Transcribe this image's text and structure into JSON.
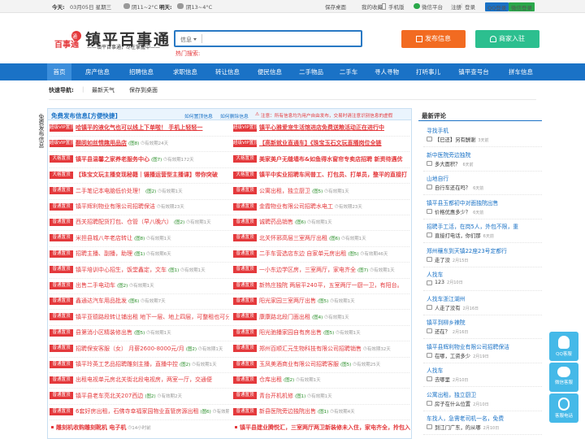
{
  "topbar": {
    "today_label": "今天:",
    "date": "03月05日 星期三",
    "weather_today": "阴11~2°C",
    "tomorrow_label": "明天:",
    "weather_tomorrow": "阴13~4°C",
    "save_desktop": "保存桌面",
    "favorites": "我的收藏",
    "mobile": "手机版",
    "wechat": "微信平台",
    "register": "注册",
    "login": "登录",
    "qq_login": "QQ登录",
    "wechat_login": "微信登录"
  },
  "header": {
    "logo_badge": "百事通",
    "title": "镇平百事通",
    "slogan": "——镇平百事通，尽在掌握中——",
    "search_category": "信息",
    "hot_label": "热门搜索:",
    "post_btn": "发布信息",
    "merchant_btn": "商家入驻"
  },
  "nav": [
    "首页",
    "房产信息",
    "招聘信息",
    "求职信息",
    "转让信息",
    "便民信息",
    "二手物品",
    "二手车",
    "寻人寻物",
    "打听事儿",
    "镇平查号台",
    "拼车信息"
  ],
  "quick": {
    "label": "快速导航:",
    "items": [
      "最新天气",
      "保存到桌面"
    ]
  },
  "panel": {
    "title": "免费发布信息[方便快捷]",
    "link_top": "如何置顶信息",
    "link_delete": "如何删除信息",
    "notice": "注意：所有信息均为用户自由发布，交易时请注意识别信息的虚假",
    "side_text": "免费发布信息"
  },
  "left_rows": [
    {
      "tag": "超级VIP置顶",
      "color": "#e4393c",
      "title": "哈镇平的液化气也可以线上下单啦！ 手机上轻轻一",
      "pic": "",
      "meta": ""
    },
    {
      "tag": "超级VIP置顶",
      "color": "#e4393c",
      "title": "翻阅如丝情趣用品店",
      "pic": "(图8)",
      "meta": "有效期24天"
    },
    {
      "tag": "大格置顶",
      "color": "#e4393c",
      "title": "镇平县温馨之家养老服务中心",
      "pic": "(图7)",
      "meta": "有效期172天"
    },
    {
      "tag": "大格置顶",
      "color": "#e4393c",
      "title": "【珠宝文玩主播变现秘籍｜镊播运营型主播课】带你突破",
      "pic": "",
      "meta": ""
    },
    {
      "tag": "普通置顶",
      "color": "#e4393c",
      "title": "二手笔记本电脑低价处理！",
      "pic": "(图2)",
      "meta": "有效期1天"
    },
    {
      "tag": "普通置顶",
      "color": "#e4393c",
      "title": "镇平辉利物业有限公司招聘保洁",
      "pic": "",
      "meta": "有效期23天"
    },
    {
      "tag": "普通置顶",
      "color": "#e4393c",
      "title": "西关招聘配货打包、仓管（早八晚六）",
      "pic": "(图2)",
      "meta": "有效期1天"
    },
    {
      "tag": "普通置顶",
      "color": "#e4393c",
      "title": "米担县城八年老店转让",
      "pic": "(图8)",
      "meta": "有效期1天"
    },
    {
      "tag": "普通置顶",
      "color": "#e4393c",
      "title": "招聘主播、副播，助理",
      "pic": "(图1)",
      "meta": "有效期6天"
    },
    {
      "tag": "普通置顶",
      "color": "#e4393c",
      "title": "镇平培训中心招生，饭堂鑫定，文车",
      "pic": "(图1)",
      "meta": "有效期1天"
    },
    {
      "tag": "普通置顶",
      "color": "#e4393c",
      "title": "出售二手电动车",
      "pic": "(图2)",
      "meta": "有效期1天"
    },
    {
      "tag": "普通置顶",
      "color": "#e4393c",
      "title": "鑫通达汽车用品批发",
      "pic": "(图6)",
      "meta": "有效期7天"
    },
    {
      "tag": "普通置顶",
      "color": "#e4393c",
      "title": "镇平亚德路段转让铺出租 地下一层、地上四层，可整租也可分",
      "pic": "",
      "meta": ""
    },
    {
      "tag": "普通置顶",
      "color": "#e4393c",
      "title": "县第消小区精装修出售",
      "pic": "(图5)",
      "meta": "有效期1天"
    },
    {
      "tag": "普通置顶",
      "color": "#e4393c",
      "title": "招聘保安客服（女） 月薪2600-8000元/月",
      "pic": "(图2)",
      "meta": "有效期1天"
    },
    {
      "tag": "普通置顶",
      "color": "#e4393c",
      "title": "镇平玲英工艺品招聘雕刻主播，直播中控",
      "pic": "(图2)",
      "meta": "有效期1天"
    },
    {
      "tag": "普通置顶",
      "color": "#e4393c",
      "title": "出租电视单元房北关街北段电视房，两室一厅，交通便",
      "pic": "",
      "meta": ""
    },
    {
      "tag": "普通置顶",
      "color": "#e4393c",
      "title": "镇平县老车亮北关207西边",
      "pic": "(图2)",
      "meta": "有效期2天"
    },
    {
      "tag": "普通置顶",
      "color": "#e4393c",
      "title": "6套好房出租，石佛寺幸福家园物业直管房源出租",
      "pic": "(图6)",
      "meta": "有效期7天"
    },
    {
      "tag": "",
      "color": "#ffffff",
      "title": "雕刻机收购雕刻靴机 电子机",
      "pic": "",
      "meta": "14小时前"
    }
  ],
  "right_rows": [
    {
      "tag": "超级VIP置顶",
      "color": "#e4393c",
      "title": "镇平心雅爱宠生活馆进店免费送粮活动正在进行中",
      "pic": "",
      "meta": ""
    },
    {
      "tag": "超级VIP置顶",
      "color": "#e4393c",
      "title": "【高新就业直通车】《珠宝玉石文玩直播岗位全链",
      "pic": "",
      "meta": ""
    },
    {
      "tag": "大格置顶",
      "color": "#e4393c",
      "title": "美家美户无缝墙布&如鱼得水窗帘专卖店招聘 新资待遇优",
      "pic": "",
      "meta": ""
    },
    {
      "tag": "大格置顶",
      "color": "#e4393c",
      "title": "镇平中实业招聘车间普工、打包员、打单员，整平的直接打",
      "pic": "",
      "meta": ""
    },
    {
      "tag": "普通置顶",
      "color": "#e4393c",
      "title": "公寓出租，独立厨卫",
      "pic": "(图5)",
      "meta": "有效期1天"
    },
    {
      "tag": "普通置顶",
      "color": "#e4393c",
      "title": "金霞物业有限公司招聘水电工",
      "pic": "",
      "meta": "有效期23天"
    },
    {
      "tag": "普通置顶",
      "color": "#e4393c",
      "title": "诚聘药品销售",
      "pic": "(图6)",
      "meta": "有效期1天"
    },
    {
      "tag": "普通置顶",
      "color": "#e4393c",
      "title": "北关怀邪高层三室两厅出租",
      "pic": "(图6)",
      "meta": "有效期1天"
    },
    {
      "tag": "普通置顶",
      "color": "#e4393c",
      "title": "二手车营选店东边 自家单元房出租",
      "pic": "(图5)",
      "meta": "有效期46天"
    },
    {
      "tag": "普通置顶",
      "color": "#e4393c",
      "title": "一小东边学区房，三室两厅，家电齐全",
      "pic": "(图7)",
      "meta": "有效期1天"
    },
    {
      "tag": "普通置顶",
      "color": "#e4393c",
      "title": "新热庄独院 两层平240平，五室两厅一厨一卫，有阳台。",
      "pic": "",
      "meta": ""
    },
    {
      "tag": "普通置顶",
      "color": "#e4393c",
      "title": "阳光家园三室两厅出售",
      "pic": "(图5)",
      "meta": "有效期1天"
    },
    {
      "tag": "普通置顶",
      "color": "#e4393c",
      "title": "康康路北段门面出租",
      "pic": "(图4)",
      "meta": "有效期1天"
    },
    {
      "tag": "普通置顶",
      "color": "#e4393c",
      "title": "阳光驰播家园自有房出售",
      "pic": "(图5)",
      "meta": "有效期1天"
    },
    {
      "tag": "普通置顶",
      "color": "#e4393c",
      "title": "郑州百顺汇元生物科技有限公司招聘销售",
      "pic": "",
      "meta": "有效期32天"
    },
    {
      "tag": "普通置顶",
      "color": "#e4393c",
      "title": "玉凤美酒商业有限公司招聘客服",
      "pic": "(图5)",
      "meta": "有效期25天"
    },
    {
      "tag": "普通置顶",
      "color": "#e4393c",
      "title": "仓库出租",
      "pic": "(图2)",
      "meta": "有效期1天"
    },
    {
      "tag": "普通置顶",
      "color": "#e4393c",
      "title": "青台开机机修",
      "pic": "(图1)",
      "meta": "有效期1天"
    },
    {
      "tag": "普通置顶",
      "color": "#e4393c",
      "title": "新县医院旁边独院出售",
      "pic": "(图1)",
      "meta": "有效期4天"
    },
    {
      "tag": "",
      "color": "#ffffff",
      "title": "镇平县建业腾悦汇，三室两厅两卫新装修未入住，家电齐全，拎包入",
      "pic": "",
      "meta": ""
    }
  ],
  "comments": {
    "title": "最新评论",
    "items": [
      {
        "title": "寻找手机",
        "body": "【已还】另有酬谢",
        "time": "3天前"
      },
      {
        "title": "新中医院旁边独院",
        "body": "多大面积？",
        "time": "6天前"
      },
      {
        "title": "山地自行",
        "body": "自行车还在吗？",
        "time": "6天前"
      },
      {
        "title": "镇平县玉都初中对面独院出售",
        "body": "价格优惠多少？",
        "time": "6天前"
      },
      {
        "title": "招聘手工活，在岗5人，外包不限，重",
        "body": "直接打电话，你们那",
        "time": "6天前"
      },
      {
        "title": "郑州穰东到天镇22座23号定都行",
        "body": "走了没",
        "time": "2月15日"
      },
      {
        "title": "人找车",
        "body": "123",
        "time": "2月10日"
      },
      {
        "title": "人找车浙江湖州",
        "body": "人走了没有",
        "time": "2月16日"
      },
      {
        "title": "镇平到柳乡辣院",
        "body": "还在？",
        "time": "2月16日"
      },
      {
        "title": "镇平县辉利物业有限公司招聘保洁",
        "body": "在哪，工资多少",
        "time": "2月19日"
      },
      {
        "title": "人找车",
        "body": "去哪里",
        "time": "2月10日"
      },
      {
        "title": "公寓出租，独立厨卫",
        "body": "房子在什么位置",
        "time": "2月10日"
      },
      {
        "title": "车找人，急需老司机一名，免费",
        "body": "到江门广东，的从哪",
        "time": "2月10日"
      }
    ]
  },
  "float": [
    {
      "label": "QQ客服"
    },
    {
      "label": "微信客服"
    },
    {
      "label": "客服电话"
    }
  ]
}
